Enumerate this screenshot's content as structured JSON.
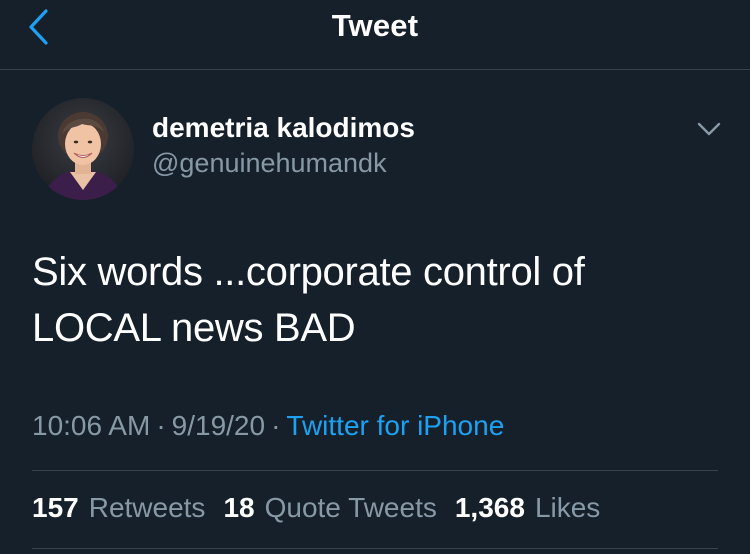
{
  "header": {
    "title": "Tweet"
  },
  "tweet": {
    "author": {
      "name": "demetria kalodimos",
      "handle": "@genuinehumandk"
    },
    "text": "Six words ...corporate control of\nLOCAL news BAD",
    "time": "10:06 AM",
    "date": "9/19/20",
    "separator": "·",
    "source": "Twitter for iPhone",
    "stats": [
      {
        "count": "157",
        "label": "Retweets"
      },
      {
        "count": "18",
        "label": "Quote Tweets"
      },
      {
        "count": "1,368",
        "label": "Likes"
      }
    ]
  },
  "colors": {
    "background": "#15202b",
    "accent": "#1da1f2",
    "secondary_text": "#8899a6",
    "divider": "#38444d"
  },
  "icons": {
    "back": "chevron-left-icon",
    "menu": "chevron-down-icon"
  }
}
